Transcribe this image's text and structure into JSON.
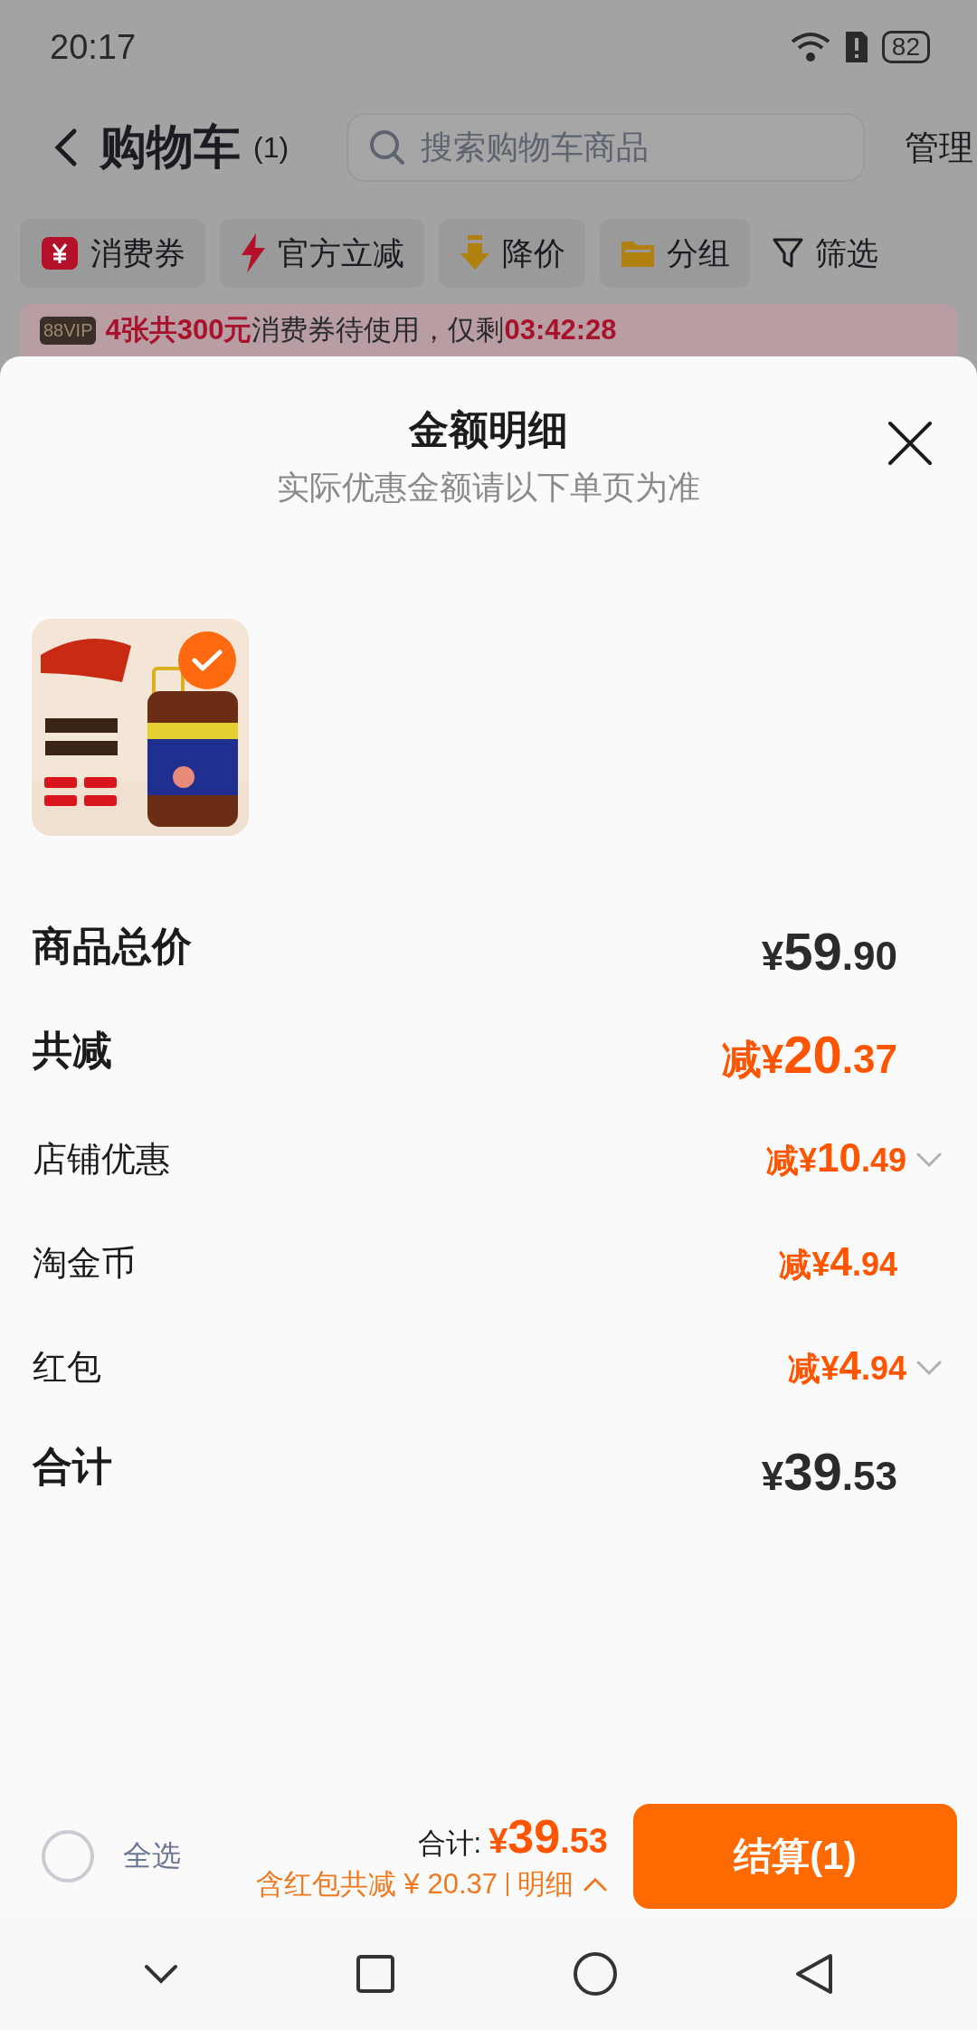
{
  "status_bar": {
    "time": "20:17",
    "battery": "82"
  },
  "header": {
    "title": "购物车",
    "count": "(1)",
    "search": {
      "placeholder": "搜索购物车商品"
    },
    "action": "管理"
  },
  "filters": [
    {
      "label": "消费券",
      "kind": "coupon"
    },
    {
      "label": "官方立减",
      "kind": "flash"
    },
    {
      "label": "降价",
      "kind": "drop"
    },
    {
      "label": "分组",
      "kind": "folder"
    },
    {
      "label": "筛选",
      "kind": "filter"
    }
  ],
  "banner": {
    "badge": "88VIP",
    "text": "**4张共300元**消费券待使用，仅剩**03:42:28**"
  },
  "sheet": {
    "title": "金额明细",
    "subtitle": "实际优惠金额请以下单页为准",
    "items": [
      {
        "kind": "picture",
        "selected": true
      }
    ],
    "rows": [
      {
        "label": "商品总价",
        "kind": "major",
        "discount": false,
        "expandable": false,
        "price": {
          "currency": "¥",
          "integer": "59",
          "decimal": ".90"
        }
      },
      {
        "label": "共减",
        "kind": "major",
        "discount": true,
        "expandable": false,
        "price": {
          "prefix": "减",
          "currency": "¥",
          "integer": "20",
          "decimal": ".37"
        }
      },
      {
        "label": "店铺优惠",
        "kind": "minor",
        "discount": true,
        "expandable": true,
        "price": {
          "prefix": "减",
          "currency": "¥",
          "integer": "10",
          "decimal": ".49"
        }
      },
      {
        "label": "淘金币",
        "kind": "minor",
        "discount": true,
        "expandable": false,
        "price": {
          "prefix": "减",
          "currency": "¥",
          "integer": "4",
          "decimal": ".94"
        }
      },
      {
        "label": "红包",
        "kind": "minor",
        "discount": true,
        "expandable": true,
        "price": {
          "prefix": "减",
          "currency": "¥",
          "integer": "4",
          "decimal": ".94"
        }
      },
      {
        "label": "合计",
        "kind": "major",
        "discount": false,
        "expandable": false,
        "price": {
          "currency": "¥",
          "integer": "39",
          "decimal": ".53"
        }
      }
    ]
  },
  "footer": {
    "select_all": {
      "label": "全选",
      "checked": false
    },
    "total_label": "合计:",
    "total": {
      "currency": "¥",
      "integer": "39",
      "decimal": ".53"
    },
    "discount_note": "含红包共减 ¥ 20.37",
    "detail_link": "明细",
    "expanded": true,
    "checkout": "结算(1)"
  }
}
